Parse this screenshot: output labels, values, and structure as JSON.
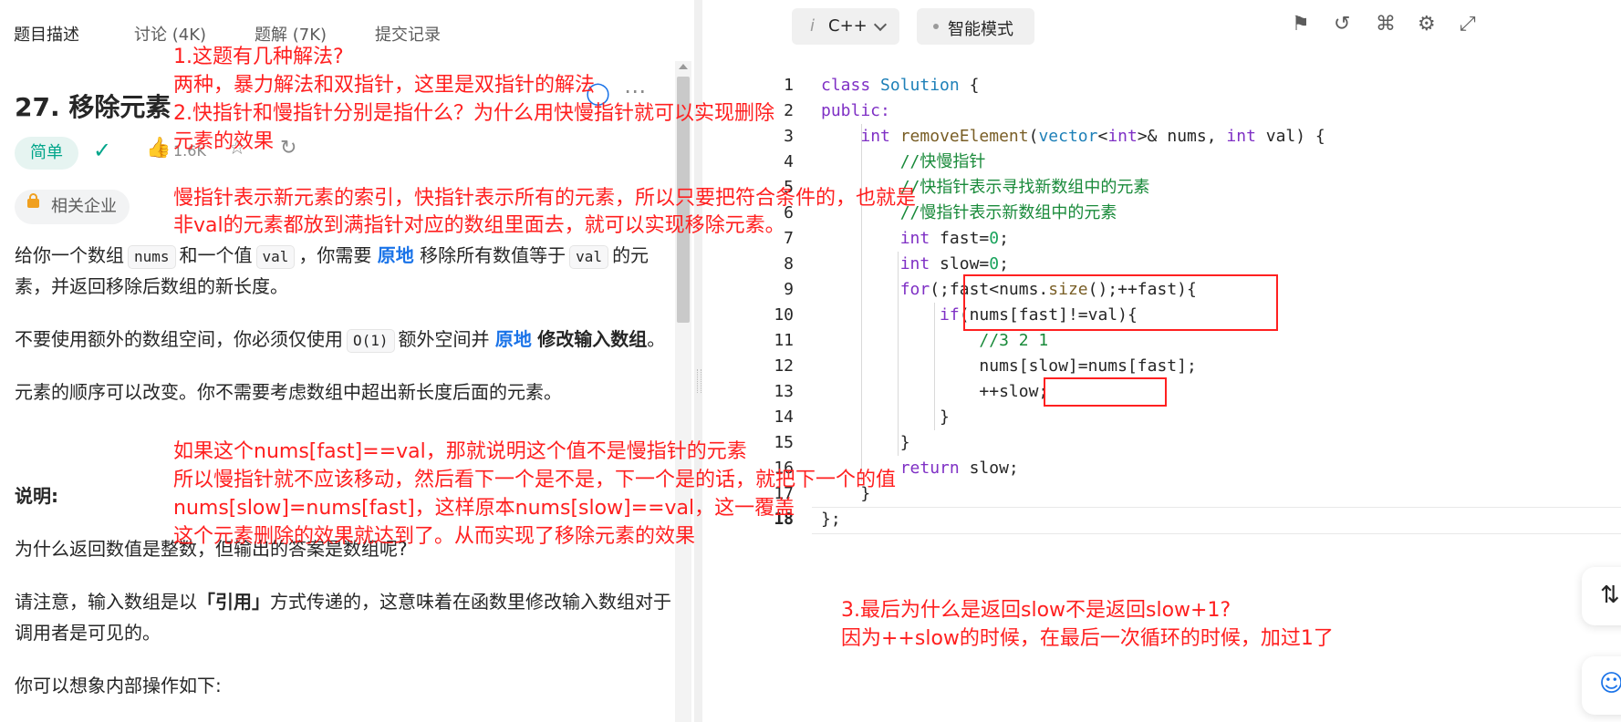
{
  "tabs": [
    "题目描述",
    "讨论 (4K)",
    "题解 (7K)",
    "提交记录"
  ],
  "problem": {
    "title": "27. 移除元素",
    "difficulty": "简单",
    "likes": "1.6K",
    "company_label": "相关企业"
  },
  "description": {
    "p1_a": "给你一个数组",
    "p1_code1": "nums",
    "p1_b": "和一个值",
    "p1_code2": "val",
    "p1_c": "，你需要",
    "p1_bold": "原地",
    "p1_d": "移除所有数值等于",
    "p1_code3": "val",
    "p1_e": "的元",
    "p1_line2": "素，并返回移除后数组的新长度。",
    "p2_a": "不要使用额外的数组空间，你必须仅使用",
    "p2_code": "O(1)",
    "p2_b": "额外空间并",
    "p2_blue": "原地",
    "p2_bold": "修改输入数组",
    "p2_c": "。",
    "p3": "元素的顺序可以改变。你不需要考虑数组中超出新长度后面的元素。",
    "heading": "说明:",
    "p4": "为什么返回数值是整数，但输出的答案是数组呢?",
    "p5_a": "请注意，输入数组是以",
    "p5_bold": "「引用」",
    "p5_b": "方式传递的，这意味着在函数里修改输入数组对于",
    "p5_line2": "调用者是可见的。",
    "p6": "你可以想象内部操作如下:"
  },
  "annotations": {
    "q1": "1.这题有几种解法?",
    "a1": "两种，暴力解法和双指针，这里是双指针的解法",
    "q2_l1": "2.快指针和慢指针分别是指什么？为什么用快慢指针就可以实现删除",
    "q2_l2": "元素的效果",
    "a2_l1": "慢指针表示新元素的索引，快指针表示所有的元素，所以只要把符合条件的，也就是",
    "a2_l2": "非val的元素都放到满指针对应的数组里面去，就可以实现移除元素。",
    "n3_l1": "如果这个nums[fast]==val，那就说明这个值不是慢指针的元素",
    "n3_l2": "所以慢指针就不应该移动，然后看下一个是不是，下一个是的话，就把下一个的值",
    "n3_l3": "nums[slow]=nums[fast]，这样原本nums[slow]==val，这一覆盖",
    "n3_l4": "这个元素删除的效果就达到了。从而实现了移除元素的效果",
    "q3": "3.最后为什么是返回slow不是返回slow+1?",
    "a3": "因为++slow的时候，在最后一次循环的时候，加过1了"
  },
  "editor": {
    "language": "C++",
    "mode": "智能模式",
    "code_lines": [
      "class Solution {",
      "public:",
      "    int removeElement(vector<int>& nums, int val) {",
      "        //快慢指针",
      "        //快指针表示寻找新数组中的元素",
      "        //慢指针表示新数组中的元素",
      "        int fast=0;",
      "        int slow=0;",
      "        for(;fast<nums.size();++fast){",
      "            if(nums[fast]!=val){",
      "                //3 2 1",
      "                nums[slow]=nums[fast];",
      "                ++slow;",
      "            }",
      "        }",
      "        return slow;",
      "    }",
      "};"
    ],
    "line_numbers": [
      "1",
      "2",
      "3",
      "4",
      "5",
      "6",
      "7",
      "8",
      "9",
      "10",
      "11",
      "12",
      "13",
      "14",
      "15",
      "16",
      "17",
      "18"
    ]
  },
  "colors": {
    "annotation": "#ff1f1f",
    "easy_badge": "#00a58a",
    "keyword": "#7f30c5",
    "comment": "#198a3a",
    "number": "#19a35c"
  }
}
